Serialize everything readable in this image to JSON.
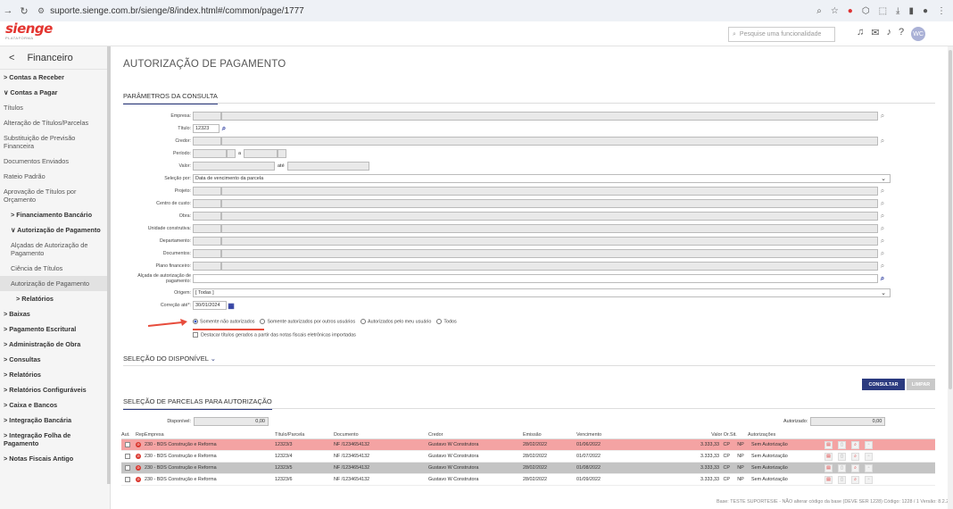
{
  "browser": {
    "url": "suporte.sienge.com.br/sienge/8/index.html#/common/page/1777"
  },
  "app": {
    "logo": "sienge",
    "logo_sub": "PLATAFORMA",
    "search_placeholder": "Pesquise uma funcionalidade",
    "avatar": "WC"
  },
  "sidebar": {
    "title": "Financeiro",
    "items": [
      {
        "label": "> Contas a Receber",
        "bold": true
      },
      {
        "label": "∨ Contas a Pagar",
        "bold": true
      },
      {
        "label": "Títulos",
        "bold": false
      },
      {
        "label": "Alteração de Títulos/Parcelas",
        "bold": false
      },
      {
        "label": "Substituição de Previsão Financeira",
        "bold": false
      },
      {
        "label": "Documentos Enviados",
        "bold": false
      },
      {
        "label": "Rateio Padrão",
        "bold": false
      },
      {
        "label": "Aprovação de Títulos por Orçamento",
        "bold": false
      },
      {
        "label": "> Financiamento Bancário",
        "bold": true
      },
      {
        "label": "∨ Autorização de Pagamento",
        "bold": true
      },
      {
        "label": "Alçadas de Autorização de Pagamento",
        "bold": false
      },
      {
        "label": "Ciência de Títulos",
        "bold": false
      },
      {
        "label": "Autorização de Pagamento",
        "bold": false
      },
      {
        "label": "> Relatórios",
        "bold": true
      },
      {
        "label": "> Baixas",
        "bold": true
      },
      {
        "label": "> Pagamento Escritural",
        "bold": true
      },
      {
        "label": "> Administração de Obra",
        "bold": true
      },
      {
        "label": "> Consultas",
        "bold": true
      },
      {
        "label": "> Relatórios",
        "bold": true
      },
      {
        "label": "> Relatórios Configuráveis",
        "bold": true
      },
      {
        "label": "> Caixa e Bancos",
        "bold": true
      },
      {
        "label": "> Integração Bancária",
        "bold": true
      },
      {
        "label": "> Integração Folha de Pagamento",
        "bold": true
      },
      {
        "label": "> Notas Fiscais Antigo",
        "bold": true
      }
    ]
  },
  "page": {
    "title": "AUTORIZAÇÃO DE PAGAMENTO",
    "params_title": "PARÂMETROS DA CONSULTA"
  },
  "form": {
    "empresa": "Empresa:",
    "titulo": "Título:",
    "titulo_value": "12323",
    "credor": "Credor:",
    "periodo": "Período:",
    "periodo_a": "a",
    "valor": "Valor:",
    "valor_ate": "até",
    "selecao": "Seleção por:",
    "selecao_value": "Data de vencimento da parcela",
    "projeto": "Projeto:",
    "centro": "Centro de custo:",
    "obra": "Obra:",
    "unidade": "Unidade construtiva:",
    "departamento": "Departamento:",
    "documentos": "Documentos:",
    "plano": "Plano financeiro:",
    "alcada": "Alçada de autorização de pagamento:",
    "origem": "Origem:",
    "origem_value": "[ Todas ]",
    "correcao": "Correção até*:",
    "correcao_value": "30/01/2024",
    "radio1": "Somente não autorizados",
    "radio2": "Somente autorizados por outros usuários",
    "radio3": "Autorizados pelo meu usuário",
    "radio4": "Todos",
    "checkbox": "Destacar títulos gerados a partir das notas fiscais eletrônicas importadas"
  },
  "disponivel_title": "SELEÇÃO DO DISPONÍVEL",
  "buttons": {
    "consultar": "CONSULTAR",
    "limpar": "LIMPAR"
  },
  "parcelas_title": "SELEÇÃO DE PARCELAS PARA AUTORIZAÇÃO",
  "summary": {
    "disponivel_label": "Disponível:",
    "disponivel_value": "0,00",
    "autorizado_label": "Autorizado:",
    "autorizado_value": "0,00"
  },
  "table": {
    "headers": [
      "Aut.",
      "Rep.",
      "Empresa",
      "Título/Parcela",
      "Documento",
      "Credor",
      "Emissão",
      "Vencimento",
      "Valor Or.",
      "Sit.",
      "Autorizações"
    ],
    "rows": [
      [
        "230 - BDS Construção e Reforma",
        "12323/3",
        "NF /1234654132",
        "Gustavo W Construtora",
        "28/02/2022",
        "01/06/2022",
        "3.333,33",
        "CP",
        "NP",
        "Sem Autorização"
      ],
      [
        "230 - BDS Construção e Reforma",
        "12323/4",
        "NF /1234654132",
        "Gustavo W Construtora",
        "28/02/2022",
        "01/07/2022",
        "3.333,33",
        "CP",
        "NP",
        "Sem Autorização"
      ],
      [
        "230 - BDS Construção e Reforma",
        "12323/5",
        "NF /1234654132",
        "Gustavo W Construtora",
        "28/02/2022",
        "01/08/2022",
        "3.333,33",
        "CP",
        "NP",
        "Sem Autorização"
      ],
      [
        "230 - BDS Construção e Reforma",
        "12323/6",
        "NF /1234654132",
        "Gustavo W Construtora",
        "28/02/2022",
        "01/09/2022",
        "3.333,33",
        "CP",
        "NP",
        "Sem Autorização"
      ]
    ]
  },
  "footer": "Base: TESTE SUPORTESIE - NÃO alterar código da base (DEVE SER 1228)  Código: 1228 / 1  Versão: 8.2.2-3",
  "colors": {
    "accent": "#2b3a7f",
    "brand": "#e3342f",
    "row_red": "#f4a3a3",
    "row_gray": "#c4c4c4"
  }
}
